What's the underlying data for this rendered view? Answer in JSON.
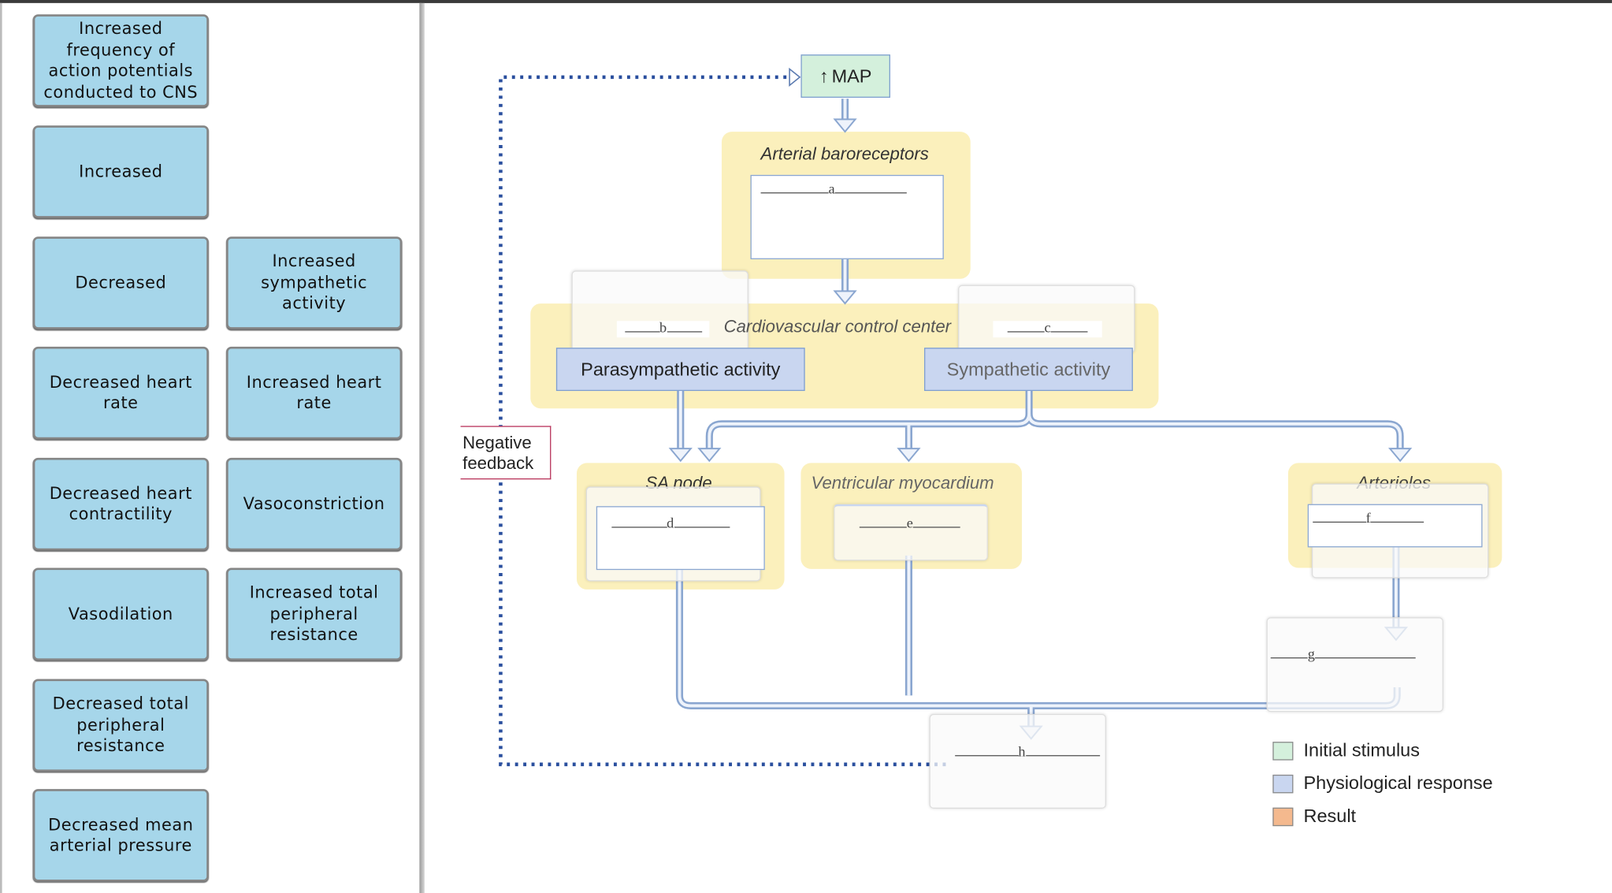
{
  "answer_bank": {
    "tiles": [
      "Increased frequency of action potentials conducted to CNS",
      "Increased",
      "Decreased",
      "Increased sympathetic activity",
      "Decreased heart rate",
      "Increased heart rate",
      "Decreased heart contractility",
      "Vasoconstriction",
      "Vasodilation",
      "Increased total peripheral resistance",
      "Decreased total peripheral resistance",
      "Decreased mean arterial pressure"
    ]
  },
  "diagram": {
    "stimulus": {
      "arrow": "↑",
      "label": "MAP"
    },
    "arterial_baroreceptors": "Arterial baroreceptors",
    "control_center": "Cardiovascular control center",
    "parasympathetic": "Parasympathetic activity",
    "sympathetic": "Sympathetic activity",
    "sa_node": "SA node",
    "ventricular": "Ventricular myocardium",
    "arterioles": "Arterioles",
    "negative_feedback": "Negative feedback",
    "blanks": {
      "a": "a",
      "b": "b",
      "c": "c",
      "d": "d",
      "e": "e",
      "f": "f",
      "g": "g",
      "h": "h"
    }
  },
  "legend": [
    {
      "label": "Initial stimulus",
      "color": "#d4f0dc"
    },
    {
      "label": "Physiological response",
      "color": "#c9d6f0"
    },
    {
      "label": "Result",
      "color": "#f4b98e"
    }
  ],
  "colors": {
    "tile": "#a6d6ea",
    "highlight": "#fbeeb5",
    "connector": "#a9c3e6",
    "feedback": "#2a4f9e"
  }
}
